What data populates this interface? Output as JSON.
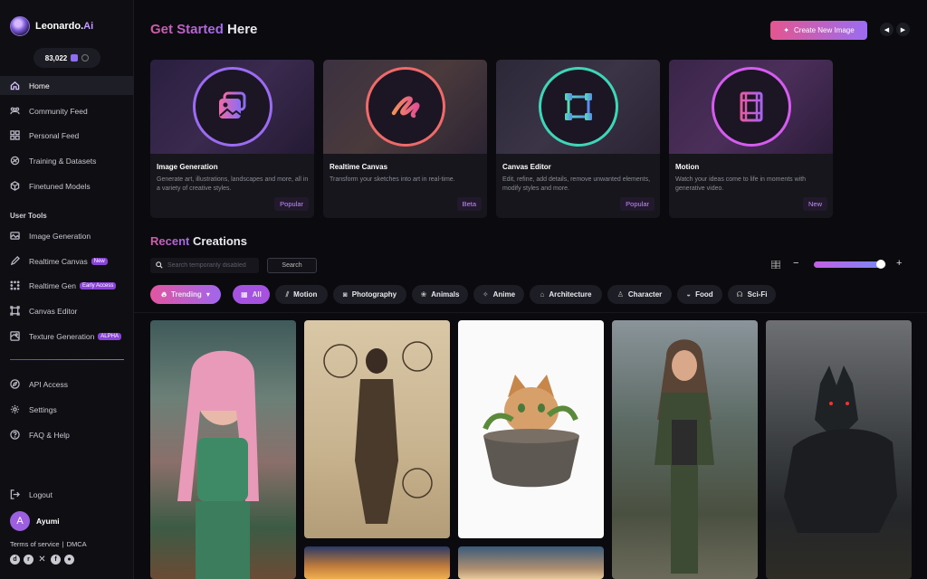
{
  "brand": {
    "name": "Leonardo.",
    "name_ai": "Ai"
  },
  "credits": {
    "amount": "83,022"
  },
  "sidebar": {
    "main": [
      {
        "label": "Home",
        "icon": "home-icon"
      },
      {
        "label": "Community Feed",
        "icon": "community-icon"
      },
      {
        "label": "Personal Feed",
        "icon": "grid-icon"
      },
      {
        "label": "Training & Datasets",
        "icon": "training-icon"
      },
      {
        "label": "Finetuned Models",
        "icon": "cube-icon"
      }
    ],
    "section_label": "User Tools",
    "tools": [
      {
        "label": "Image Generation",
        "icon": "image-icon",
        "badge": ""
      },
      {
        "label": "Realtime Canvas",
        "icon": "brush-icon",
        "badge": "New"
      },
      {
        "label": "Realtime Gen",
        "icon": "dots-icon",
        "badge": "Early Access"
      },
      {
        "label": "Canvas Editor",
        "icon": "canvas-icon",
        "badge": ""
      },
      {
        "label": "Texture Generation",
        "icon": "texture-icon",
        "badge": "ALPHA"
      }
    ],
    "bottom": [
      {
        "label": "API Access",
        "icon": "compass-icon"
      },
      {
        "label": "Settings",
        "icon": "gear-icon"
      },
      {
        "label": "FAQ & Help",
        "icon": "help-icon"
      }
    ],
    "logout": "Logout",
    "user": {
      "initial": "A",
      "name": "Ayumi"
    },
    "legal": {
      "terms": "Terms of service",
      "sep": "|",
      "dmca": "DMCA"
    },
    "socials": [
      "discord-icon",
      "reddit-icon",
      "x-icon",
      "facebook-icon",
      "apple-icon"
    ]
  },
  "header": {
    "title_accent": "Get Started",
    "title_rest": " Here",
    "create_button": "Create New Image",
    "prev": "◀",
    "next": "▶"
  },
  "features": [
    {
      "title": "Image Generation",
      "desc": "Generate art, illustrations, landscapes and more, all in a variety of creative styles.",
      "tag": "Popular",
      "icon": "image-stack-icon",
      "ring": "#9b6cf2"
    },
    {
      "title": "Realtime Canvas",
      "desc": "Transform your sketches into art in real-time.",
      "tag": "Beta",
      "icon": "scribble-icon",
      "ring": "#f06a6a"
    },
    {
      "title": "Canvas Editor",
      "desc": "Edit, refine, add details, remove unwanted elements, modify styles and more.",
      "tag": "Popular",
      "icon": "crop-frame-icon",
      "ring": "#3fd6b8"
    },
    {
      "title": "Motion",
      "desc": "Watch your ideas come to life in moments with generative video.",
      "tag": "New",
      "icon": "film-icon",
      "ring": "#d65cf0"
    }
  ],
  "recent": {
    "title_accent": "Recent",
    "title_rest": " Creations",
    "search_placeholder": "Search temporarily disabled",
    "search_button": "Search",
    "zoom_minus": "−",
    "zoom_plus": "+",
    "zoom_level": 0.93,
    "filters": [
      {
        "label": "Trending",
        "icon": "fire-icon"
      },
      {
        "label": "All",
        "icon": "grid-icon"
      },
      {
        "label": "Motion",
        "icon": "motion-icon"
      },
      {
        "label": "Photography",
        "icon": "camera-icon"
      },
      {
        "label": "Animals",
        "icon": "paw-icon"
      },
      {
        "label": "Anime",
        "icon": "sparkle-icon"
      },
      {
        "label": "Architecture",
        "icon": "building-icon"
      },
      {
        "label": "Character",
        "icon": "person-icon"
      },
      {
        "label": "Food",
        "icon": "bowl-icon"
      },
      {
        "label": "Sci-Fi",
        "icon": "alien-icon"
      }
    ]
  },
  "gallery": [
    {
      "name": "elf-sorceress-image"
    },
    {
      "name": "sketchbook-adventurer-image"
    },
    {
      "name": "kitten-in-pot-image"
    },
    {
      "name": "warrior-woman-image"
    },
    {
      "name": "dark-wolf-image"
    },
    {
      "name": "glowing-scene-image"
    },
    {
      "name": "blonde-portrait-image"
    }
  ],
  "colors": {
    "accent_pink": "#e3568f",
    "accent_purple": "#9b6cf2",
    "bg": "#0b0b0f"
  }
}
